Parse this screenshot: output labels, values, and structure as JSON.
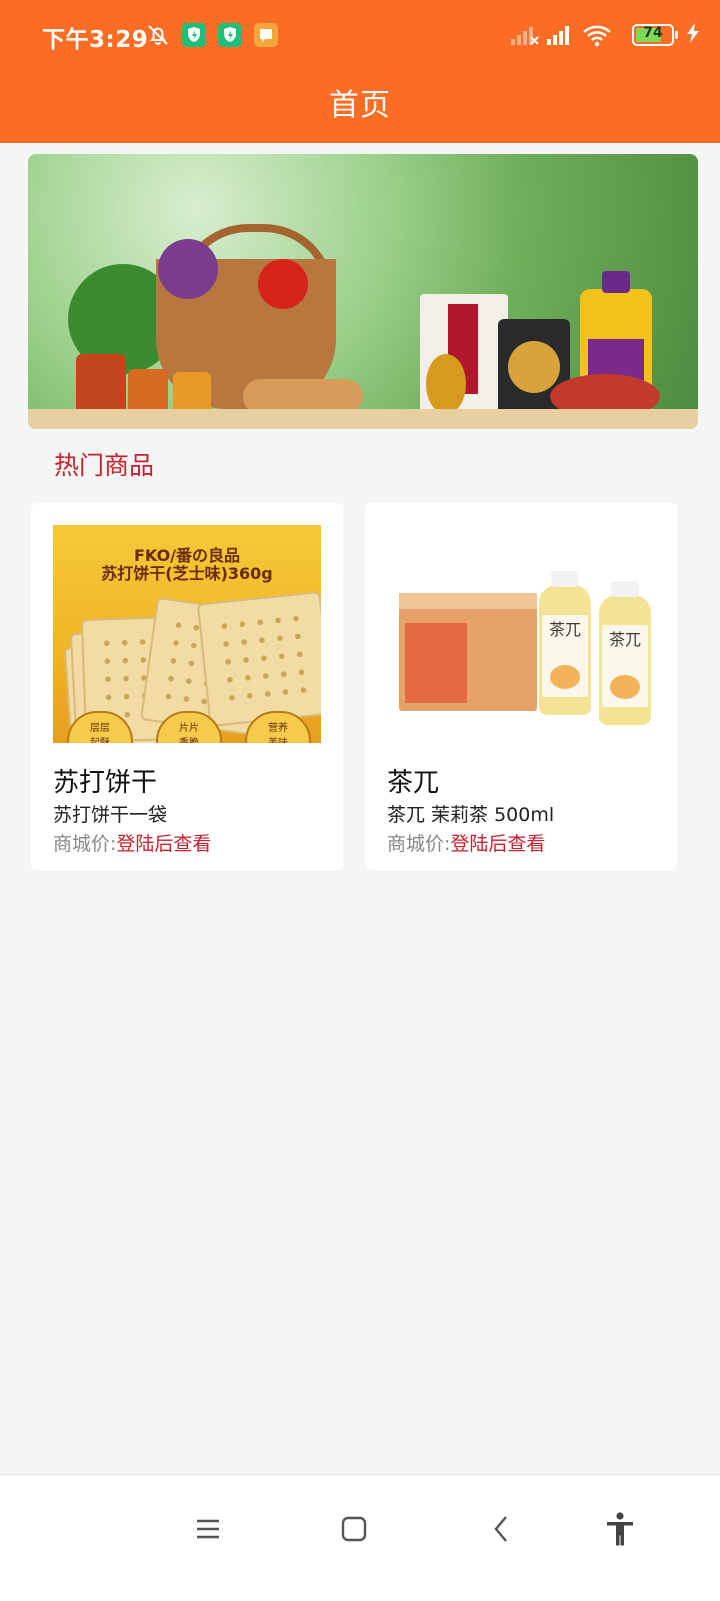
{
  "status_bar": {
    "time": "下午3:29",
    "battery": "74",
    "battery_level": 0.74,
    "icons": [
      "bell-off-icon",
      "security-icon",
      "security-icon",
      "message-icon",
      "signal-off-icon",
      "signal-icon",
      "wifi-icon",
      "battery-icon",
      "charging-icon"
    ]
  },
  "header": {
    "title": "首页"
  },
  "banner": {
    "icon": "grocery-banner-image"
  },
  "section": {
    "title": "热门商品"
  },
  "products": [
    {
      "image_text_line1": "FKO/番の良品",
      "image_text_line2": "苏打饼干(芝士味)360g",
      "badges": [
        "层层",
        "片片",
        "营养"
      ],
      "badges_sub": [
        "起酥",
        "香脆",
        "美味"
      ],
      "name": "苏打饼干",
      "desc": "苏打饼干一袋",
      "price_label": "商城价:",
      "price_value": "登陆后查看"
    },
    {
      "bottle_text": "茶兀",
      "name": "茶兀",
      "desc": "茶兀 茉莉茶 500ml",
      "price_label": "商城价:",
      "price_value": "登陆后查看"
    }
  ],
  "nav": {
    "icons": [
      "menu-icon",
      "home-icon",
      "back-icon",
      "accessibility-icon"
    ]
  },
  "colors": {
    "primary": "#fb6c25",
    "accent": "#c8202d",
    "background": "#f4f5f5"
  }
}
